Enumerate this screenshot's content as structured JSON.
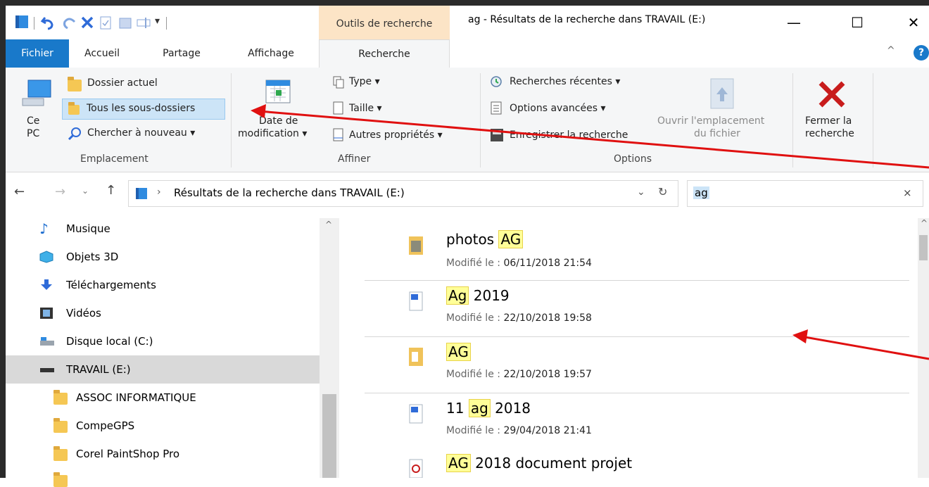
{
  "window": {
    "title": "ag - Résultats de la recherche dans TRAVAIL (E:)",
    "contextual_tab": "Outils de recherche",
    "minimize": "—",
    "maximize": "☐",
    "close": "✕"
  },
  "tabs": {
    "file": "Fichier",
    "home": "Accueil",
    "share": "Partage",
    "view": "Affichage",
    "search": "Recherche"
  },
  "ribbon": {
    "location": {
      "this_pc_line1": "Ce",
      "this_pc_line2": "PC",
      "current_folder": "Dossier actuel",
      "all_subfolders": "Tous les sous-dossiers",
      "search_again": "Chercher à nouveau ▾",
      "group_label": "Emplacement"
    },
    "refine": {
      "date_line1": "Date de",
      "date_line2": "modification ▾",
      "type": "Type ▾",
      "size": "Taille ▾",
      "other_props": "Autres propriétés ▾",
      "group_label": "Affiner"
    },
    "options": {
      "recent": "Recherches récentes ▾",
      "advanced": "Options avancées ▾",
      "save": "Enregistrer la recherche",
      "open_loc_line1": "Ouvrir l'emplacement",
      "open_loc_line2": "du fichier",
      "close_line1": "Fermer la",
      "close_line2": "recherche",
      "group_label": "Options"
    }
  },
  "address": {
    "path": "Résultats de la recherche dans TRAVAIL (E:)",
    "search_value": "ag"
  },
  "nav": [
    {
      "label": "Musique"
    },
    {
      "label": "Objets 3D"
    },
    {
      "label": "Téléchargements"
    },
    {
      "label": "Vidéos"
    },
    {
      "label": "Disque local (C:)"
    },
    {
      "label": "TRAVAIL (E:)"
    },
    {
      "label": "ASSOC INFORMATIQUE"
    },
    {
      "label": "CompeGPS"
    },
    {
      "label": "Corel PaintShop Pro"
    }
  ],
  "results": [
    {
      "pre": "photos ",
      "hl": "AG",
      "post": "",
      "date": "06/11/2018 21:54"
    },
    {
      "pre": "",
      "hl": "Ag",
      "post": " 2019",
      "date": "22/10/2018 19:58"
    },
    {
      "pre": "",
      "hl": "AG",
      "post": "",
      "date": "22/10/2018 19:57"
    },
    {
      "pre": "11 ",
      "hl": "ag",
      "post": " 2018",
      "date": "29/04/2018 21:41"
    },
    {
      "pre": "",
      "hl": "AG",
      "post": " 2018 document projet",
      "date": ""
    }
  ],
  "modified_label": "Modifié le : ",
  "colors": {
    "accent": "#1979ca",
    "contextual_tab": "#fce4c6",
    "highlight": "#ffff98",
    "annotation_arrow": "#e01010"
  }
}
